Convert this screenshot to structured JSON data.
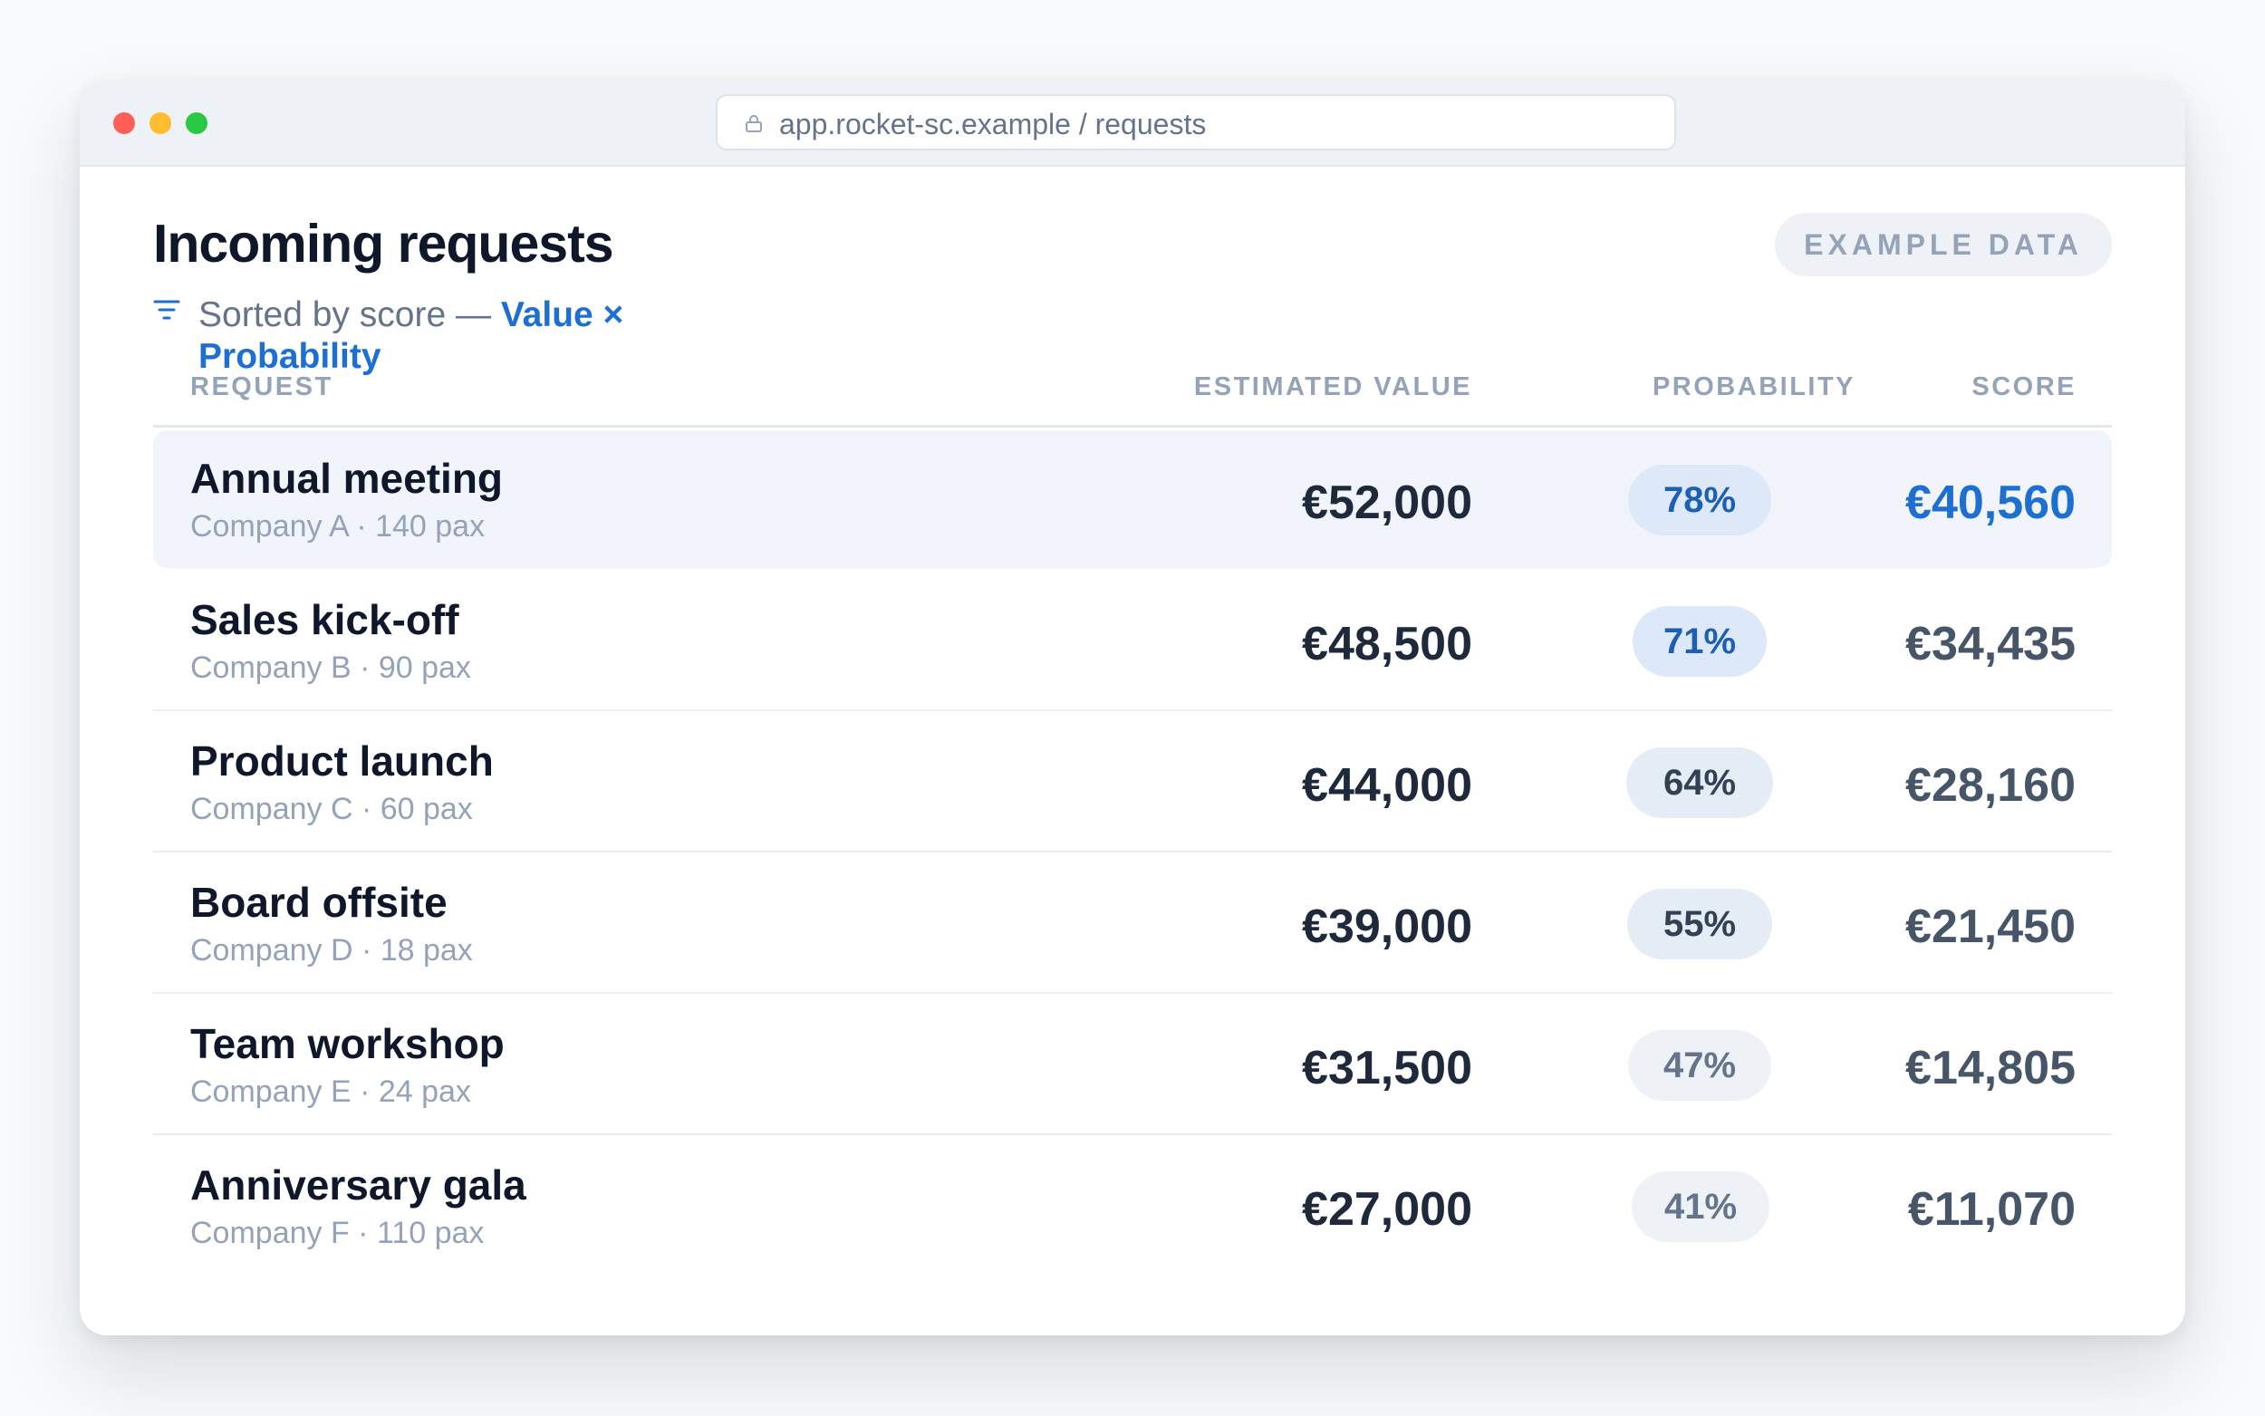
{
  "browser": {
    "url": "app.rocket-sc.example / requests"
  },
  "page": {
    "title": "Incoming requests",
    "sort_prefix": "Sorted by score — ",
    "sort_formula": "Value × Probability",
    "badge": "EXAMPLE DATA"
  },
  "table": {
    "headers": {
      "request": "REQUEST",
      "value": "ESTIMATED VALUE",
      "probability": "PROBABILITY",
      "score": "SCORE"
    },
    "rows": [
      {
        "name": "Annual meeting",
        "sub": "Company A · 140 pax",
        "value": "€52,000",
        "probability": "78%",
        "score": "€40,560"
      },
      {
        "name": "Sales kick-off",
        "sub": "Company B · 90 pax",
        "value": "€48,500",
        "probability": "71%",
        "score": "€34,435"
      },
      {
        "name": "Product launch",
        "sub": "Company C · 60 pax",
        "value": "€44,000",
        "probability": "64%",
        "score": "€28,160"
      },
      {
        "name": "Board offsite",
        "sub": "Company D · 18 pax",
        "value": "€39,000",
        "probability": "55%",
        "score": "€21,450"
      },
      {
        "name": "Team workshop",
        "sub": "Company E · 24 pax",
        "value": "€31,500",
        "probability": "47%",
        "score": "€14,805"
      },
      {
        "name": "Anniversary gala",
        "sub": "Company F · 110 pax",
        "value": "€27,000",
        "probability": "41%",
        "score": "€11,070"
      }
    ]
  },
  "colors": {
    "accent": "#1d6fd1",
    "highlight_row": "#f1f5fb",
    "dot_red": "#ff5f57",
    "dot_yellow": "#febc2e",
    "dot_green": "#28c840"
  }
}
